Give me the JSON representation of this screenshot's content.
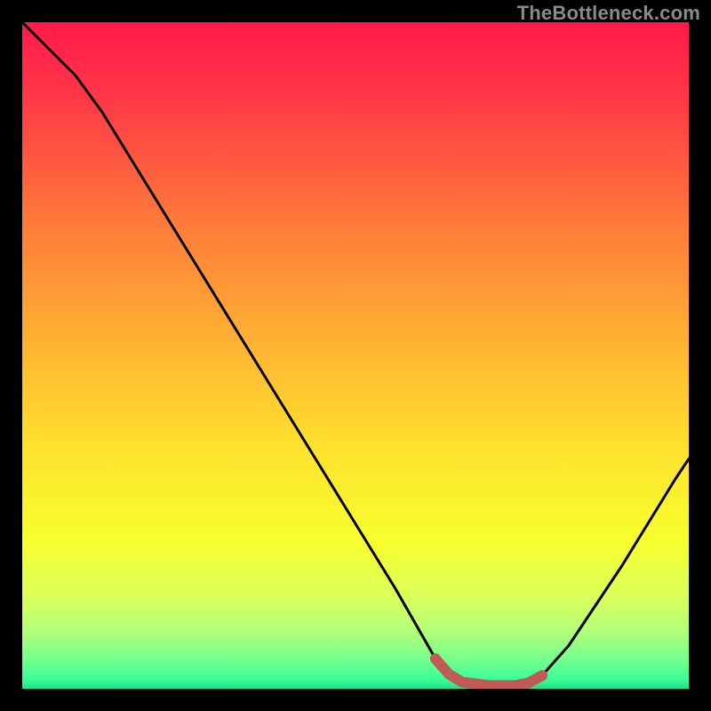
{
  "watermark": "TheBottleneck.com",
  "chart_data": {
    "type": "line",
    "title": "",
    "xlabel": "",
    "ylabel": "",
    "xlim": [
      0,
      100
    ],
    "ylim": [
      0,
      100
    ],
    "series": [
      {
        "name": "bottleneck-curve",
        "x": [
          0,
          4,
          8,
          12,
          16,
          20,
          24,
          28,
          32,
          36,
          40,
          44,
          48,
          52,
          56,
          60,
          62,
          64,
          66,
          70,
          74,
          76,
          78,
          82,
          86,
          90,
          94,
          98,
          100
        ],
        "y": [
          100,
          96,
          92,
          86.5,
          80,
          73.5,
          67,
          60.5,
          54,
          47.5,
          41,
          34.5,
          28,
          21.5,
          15,
          8,
          4.5,
          2.2,
          1.0,
          0.5,
          0.5,
          0.9,
          2.0,
          6.5,
          12.5,
          18.5,
          25,
          31.5,
          34.5
        ]
      },
      {
        "name": "optimal-band",
        "x": [
          62,
          64,
          66,
          70,
          74,
          76,
          78
        ],
        "y": [
          4.5,
          2.2,
          1.0,
          0.5,
          0.5,
          0.9,
          2.0
        ]
      }
    ],
    "gradient_stops": [
      {
        "offset": 0.0,
        "color": "#ff1a4b"
      },
      {
        "offset": 0.12,
        "color": "#ff3a47"
      },
      {
        "offset": 0.3,
        "color": "#ff7a3a"
      },
      {
        "offset": 0.48,
        "color": "#ffb233"
      },
      {
        "offset": 0.64,
        "color": "#ffe22e"
      },
      {
        "offset": 0.78,
        "color": "#f7ff2e"
      },
      {
        "offset": 0.86,
        "color": "#dcff5a"
      },
      {
        "offset": 0.91,
        "color": "#b6ff77"
      },
      {
        "offset": 0.95,
        "color": "#7fff8a"
      },
      {
        "offset": 0.985,
        "color": "#3dff97"
      },
      {
        "offset": 1.0,
        "color": "#1fdf8a"
      }
    ],
    "band_color": "#c05a55",
    "curve_color": "#000000"
  }
}
